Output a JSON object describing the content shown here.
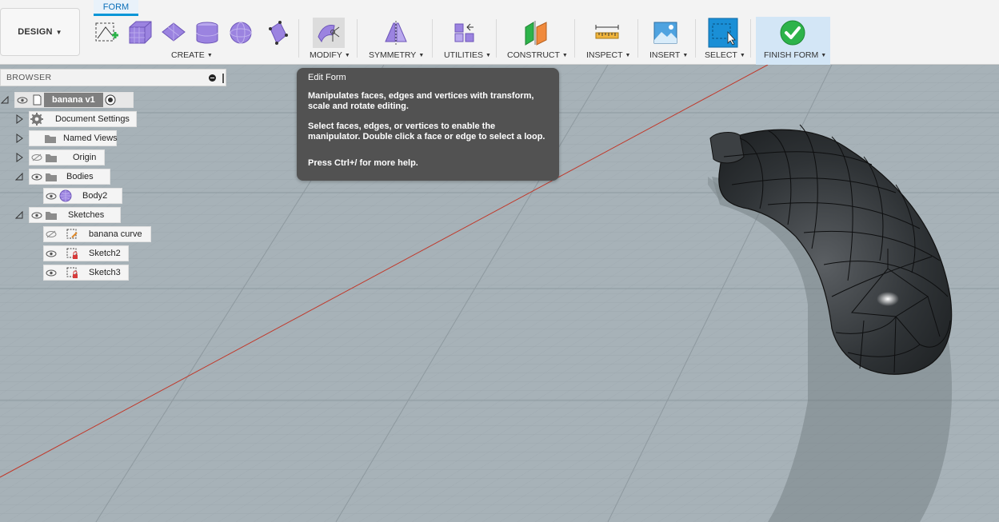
{
  "toolbar": {
    "design_label": "DESIGN",
    "tab": "FORM",
    "groups": [
      {
        "label": "CREATE"
      },
      {
        "label": "MODIFY"
      },
      {
        "label": "SYMMETRY"
      },
      {
        "label": "UTILITIES"
      },
      {
        "label": "CONSTRUCT"
      },
      {
        "label": "INSPECT"
      },
      {
        "label": "INSERT"
      },
      {
        "label": "SELECT"
      },
      {
        "label": "FINISH FORM"
      }
    ]
  },
  "browser": {
    "title": "BROWSER",
    "root_label": "banana v1",
    "items": [
      {
        "label": "Document Settings"
      },
      {
        "label": "Named Views"
      },
      {
        "label": "Origin"
      },
      {
        "label": "Bodies"
      },
      {
        "label": "Body2"
      },
      {
        "label": "Sketches"
      },
      {
        "label": "banana curve"
      },
      {
        "label": "Sketch2"
      },
      {
        "label": "Sketch3"
      }
    ]
  },
  "tooltip": {
    "title": "Edit Form",
    "line1": "Manipulates faces, edges and vertices with transform, scale and rotate editing.",
    "line2": "Select faces, edges, or vertices to enable the manipulator. Double click a face or edge to select a loop.",
    "help": "Press Ctrl+/ for more help."
  },
  "colors": {
    "accent": "#0696d7",
    "form_purple": "#9b83e0",
    "finish_green": "#2db34a",
    "tooltip_bg": "#525252",
    "viewport_bg": "#a7b2b8"
  }
}
